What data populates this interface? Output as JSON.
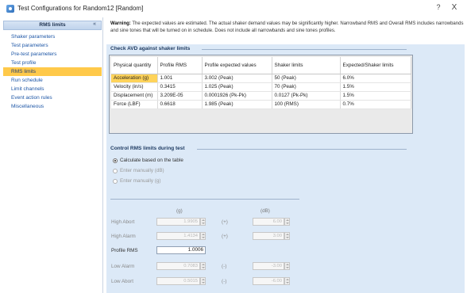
{
  "window": {
    "title": "Test Configurations for Random12 [Random]",
    "help_glyph": "?",
    "close_glyph": "X"
  },
  "sidebar": {
    "header_label": "RMS limits",
    "collapse_glyph": "«",
    "items": [
      {
        "label": "Shaker parameters"
      },
      {
        "label": "Test parameters"
      },
      {
        "label": "Pre-test parameters"
      },
      {
        "label": "Test profile"
      },
      {
        "label": "RMS limits"
      },
      {
        "label": "Run schedule"
      },
      {
        "label": "Limit channels"
      },
      {
        "label": "Event action rules"
      },
      {
        "label": "Miscellaneous"
      }
    ]
  },
  "warning": {
    "label": "Warning:",
    "text": " The expected values are estimated. The actual shaker demand values may be significantly higher. Narrowband RMS and Overall RMS includes narrowbands and sine tones that will be turned on in schedule. Does not include all narrowbands and sine tones profiles."
  },
  "avd": {
    "title": "Check AVD against shaker limits",
    "headers": [
      "Physical quantity",
      "Profile RMS",
      "Profile expected values",
      "Shaker limits",
      "Expected/Shaker limits"
    ],
    "rows": [
      [
        "Acceleration (g)",
        "1.001",
        "3.002 (Peak)",
        "50 (Peak)",
        "6.0%"
      ],
      [
        "Velocity (in/s)",
        "0.3415",
        "1.025 (Peak)",
        "70 (Peak)",
        "1.5%"
      ],
      [
        "Displacement (m)",
        "3.209E-05",
        "0.0001926 (Pk-Pk)",
        "0.0127 (Pk-Pk)",
        "1.5%"
      ],
      [
        "Force (LBF)",
        "0.6618",
        "1.985 (Peak)",
        "100 (RMS)",
        "0.7%"
      ]
    ]
  },
  "control": {
    "title": "Control RMS limits during test",
    "options": [
      {
        "label": "Calculate based on the table",
        "checked": true
      },
      {
        "label": "Enter manually (dB)",
        "checked": false
      },
      {
        "label": "Enter manually (g)",
        "checked": false
      }
    ],
    "col_g": "(g)",
    "col_db": "(dB)",
    "rows": {
      "high_abort": {
        "label": "High Abort",
        "g": "1.9905",
        "op": "(+)",
        "db": "6.00"
      },
      "high_alarm": {
        "label": "High Alarm",
        "g": "1.4134",
        "op": "(+)",
        "db": "3.00"
      },
      "profile_rms": {
        "label": "Profile RMS",
        "g": "1.0006"
      },
      "low_alarm": {
        "label": "Low Alarm",
        "g": "0.7083",
        "op": "(-)",
        "db": "-3.00"
      },
      "low_abort": {
        "label": "Low Abort",
        "g": "0.5015",
        "op": "(-)",
        "db": "-6.00"
      }
    }
  }
}
